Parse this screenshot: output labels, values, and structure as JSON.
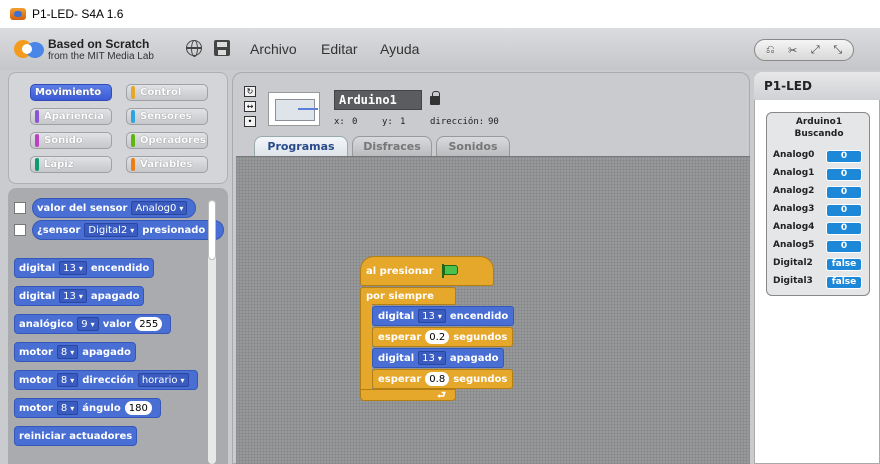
{
  "window": {
    "title": "P1-LED- S4A 1.6"
  },
  "menubar": {
    "brand_line1": "Based on Scratch",
    "brand_line2": "from the MIT Media Lab",
    "menus": [
      "Archivo",
      "Editar",
      "Ayuda"
    ]
  },
  "categories": [
    {
      "label": "Movimiento",
      "color": "#4a6fd4",
      "selected": true
    },
    {
      "label": "Control",
      "color": "#e6a82a",
      "selected": false
    },
    {
      "label": "Apariencia",
      "color": "#8a55d7",
      "selected": false
    },
    {
      "label": "Sensores",
      "color": "#2ca5e2",
      "selected": false
    },
    {
      "label": "Sonido",
      "color": "#bb42c3",
      "selected": false
    },
    {
      "label": "Operadores",
      "color": "#5cb712",
      "selected": false
    },
    {
      "label": "Lápiz",
      "color": "#0e9a6c",
      "selected": false
    },
    {
      "label": "Variables",
      "color": "#ee7d16",
      "selected": false
    }
  ],
  "palette": {
    "sensor_value": {
      "label": "valor del sensor",
      "dropdown": "Analog0"
    },
    "sensor_pressed": {
      "label": "¿sensor",
      "dropdown": "Digital2",
      "suffix": "presionado"
    },
    "digital_on": {
      "label": "digital",
      "dropdown": "13",
      "suffix": "encendido"
    },
    "digital_off": {
      "label": "digital",
      "dropdown": "13",
      "suffix": "apagado"
    },
    "analog": {
      "label": "analógico",
      "dropdown": "9",
      "mid": "valor",
      "value": "255"
    },
    "motor_off": {
      "label": "motor",
      "dropdown": "8",
      "suffix": "apagado"
    },
    "motor_dir": {
      "label": "motor",
      "dropdown": "8",
      "mid": "dirección",
      "dropdown2": "horario"
    },
    "motor_angle": {
      "label": "motor",
      "dropdown": "8",
      "mid": "ángulo",
      "value": "180"
    },
    "reset": {
      "label": "reiniciar actuadores"
    }
  },
  "sprite": {
    "name": "Arduino1",
    "x_label": "x:",
    "x": "0",
    "y_label": "y:",
    "y": "1",
    "dir_label": "dirección:",
    "direction": "90"
  },
  "tabs": [
    {
      "label": "Programas",
      "active": true
    },
    {
      "label": "Disfraces",
      "active": false
    },
    {
      "label": "Sonidos",
      "active": false
    }
  ],
  "script": {
    "hat": "al presionar",
    "forever": "por siempre",
    "b1": {
      "label": "digital",
      "dropdown": "13",
      "suffix": "encendido"
    },
    "b2": {
      "label": "esperar",
      "value": "0.2",
      "suffix": "segundos"
    },
    "b3": {
      "label": "digital",
      "dropdown": "13",
      "suffix": "apagado"
    },
    "b4": {
      "label": "esperar",
      "value": "0.8",
      "suffix": "segundos"
    }
  },
  "stage": {
    "title": "P1-LED",
    "board_line1": "Arduino1",
    "board_line2": "Buscando",
    "sensors": [
      {
        "name": "Analog0",
        "value": "0"
      },
      {
        "name": "Analog1",
        "value": "0"
      },
      {
        "name": "Analog2",
        "value": "0"
      },
      {
        "name": "Analog3",
        "value": "0"
      },
      {
        "name": "Analog4",
        "value": "0"
      },
      {
        "name": "Analog5",
        "value": "0"
      },
      {
        "name": "Digital2",
        "value": "false"
      },
      {
        "name": "Digital3",
        "value": "false"
      }
    ]
  }
}
